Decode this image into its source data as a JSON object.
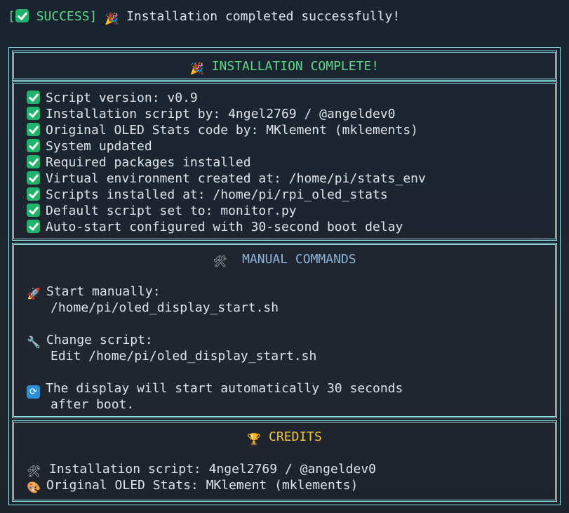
{
  "status_line": {
    "open_bracket": "[",
    "check_icon": "check-mark-button-icon",
    "tag": "SUCCESS]",
    "party_icon": "party-popper-icon",
    "message": "Installation completed successfully!"
  },
  "title_section": {
    "icon": "party-popper-icon",
    "heading": "INSTALLATION COMPLETE!"
  },
  "summary": {
    "items": [
      {
        "icon": "check-mark-button-icon",
        "text": "Script version: v0.9"
      },
      {
        "icon": "check-mark-button-icon",
        "text": "Installation script by: 4ngel2769 / @angeldev0"
      },
      {
        "icon": "check-mark-button-icon",
        "text": "Original OLED Stats code by: MKlement (mklements)"
      },
      {
        "icon": "check-mark-button-icon",
        "text": "System updated"
      },
      {
        "icon": "check-mark-button-icon",
        "text": "Required packages installed"
      },
      {
        "icon": "check-mark-button-icon",
        "text": "Virtual environment created at: /home/pi/stats_env"
      },
      {
        "icon": "check-mark-button-icon",
        "text": "Scripts installed at: /home/pi/rpi_oled_stats"
      },
      {
        "icon": "check-mark-button-icon",
        "text": "Default script set to: monitor.py"
      },
      {
        "icon": "check-mark-button-icon",
        "text": "Auto-start configured with 30-second boot delay"
      }
    ]
  },
  "manual": {
    "icon": "hammer-and-wrench-icon",
    "heading": "MANUAL COMMANDS",
    "start": {
      "icon": "rocket-icon",
      "label": "Start manually:",
      "command": "/home/pi/oled_display_start.sh"
    },
    "change": {
      "icon": "wrench-icon",
      "label": "Change script:",
      "command": "Edit /home/pi/oled_display_start.sh"
    },
    "auto": {
      "icon": "refresh-arrows-icon",
      "line1": "The display will start automatically 30 seconds",
      "line2": "after boot."
    }
  },
  "credits": {
    "icon": "trophy-icon",
    "heading": "CREDITS",
    "installer": {
      "icon": "hammer-and-wrench-icon",
      "text": "Installation script: 4ngel2769 / @angeldev0"
    },
    "original": {
      "icon": "artist-palette-icon",
      "text": "Original OLED Stats: MKlement (mklements)"
    }
  },
  "colors": {
    "border": "#8fe5ea",
    "success_green": "#5fd787",
    "manual_blue": "#8fb3d9",
    "credits_yellow": "#f0c93a",
    "text": "#dde3ea"
  }
}
